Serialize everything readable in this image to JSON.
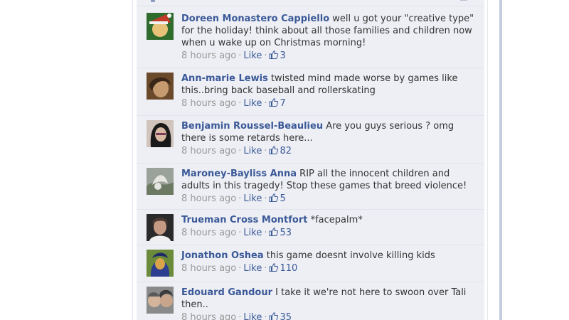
{
  "comments": [
    {
      "author": "Doreen Monastero Cappiello",
      "text": "well u got your \"creative type\" for the holiday! think about all those families and children now when u wake up on Christmas morning!",
      "time": "8 hours ago",
      "like_label": "Like",
      "likes": "3",
      "separator": "·",
      "avatar_colors": [
        "#c33a2a",
        "#2f6b2c",
        "#e9c27a"
      ]
    },
    {
      "author": "Ann-marie Lewis",
      "text": "twisted mind made worse by games like this..bring back baseball and rollerskating",
      "time": "8 hours ago",
      "like_label": "Like",
      "likes": "7",
      "separator": "·",
      "avatar_colors": [
        "#6b4a2c",
        "#c79b70",
        "#3a2718"
      ]
    },
    {
      "author": "Benjamin Roussel-Beaulieu",
      "text": "Are you guys serious ? omg there is some retards here...",
      "time": "8 hours ago",
      "like_label": "Like",
      "likes": "82",
      "separator": "·",
      "avatar_colors": [
        "#1a1a1a",
        "#d8b9a3",
        "#7a3b5a"
      ]
    },
    {
      "author": "Maroney-Bayliss Anna",
      "text": "RIP all the innocent children and adults in this tragedy! Stop these games that breed violence!",
      "time": "8 hours ago",
      "like_label": "Like",
      "likes": "5",
      "separator": "·",
      "avatar_colors": [
        "#9aa29a",
        "#e6e6e0",
        "#6d7a63"
      ]
    },
    {
      "author": "Trueman Cross Montfort",
      "text": "*facepalm*",
      "time": "8 hours ago",
      "like_label": "Like",
      "likes": "53",
      "separator": "·",
      "avatar_colors": [
        "#2a2a2a",
        "#c59a82",
        "#4a3a33"
      ]
    },
    {
      "author": "Jonathon Oshea",
      "text": "this game doesnt involve killing kids",
      "time": "8 hours ago",
      "like_label": "Like",
      "likes": "110",
      "separator": "·",
      "avatar_colors": [
        "#2b3e8f",
        "#d9a34a",
        "#6b8a3a"
      ]
    },
    {
      "author": "Edouard Gandour",
      "text": "I take it we're not here to swoon over Tali then..",
      "time": "8 hours ago",
      "like_label": "Like",
      "likes": "35",
      "separator": "·",
      "avatar_colors": [
        "#8a8a8a",
        "#d4b49a",
        "#3a3a3a"
      ]
    }
  ]
}
